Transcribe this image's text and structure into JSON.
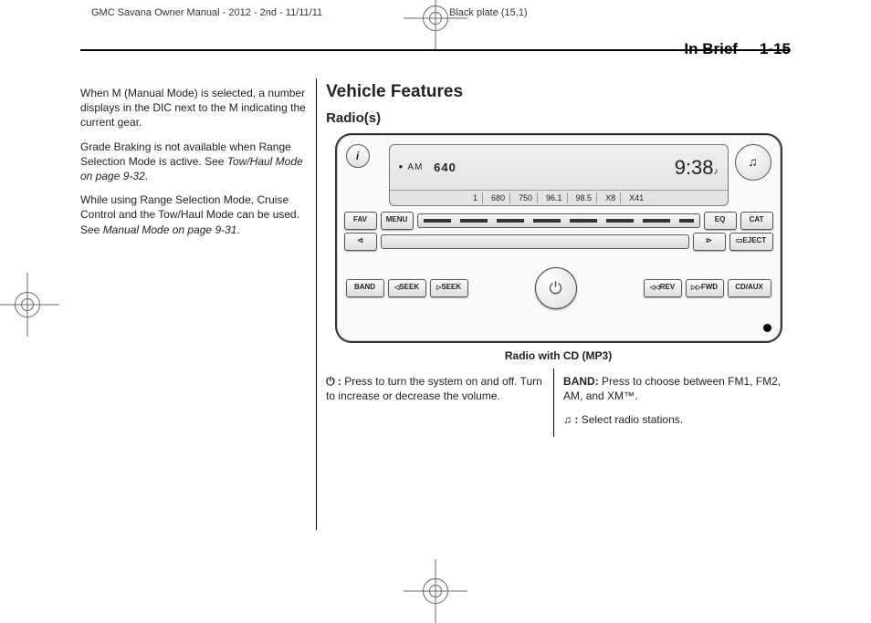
{
  "header": {
    "left": "GMC Savana Owner Manual - 2012 - 2nd - 11/11/11",
    "right": "Black plate (15,1)"
  },
  "running": {
    "section": "In Brief",
    "page": "1-15"
  },
  "col1": {
    "p1": "When M (Manual Mode) is selected, a number displays in the DIC next to the M indicating the current gear.",
    "p2a": "Grade Braking is not available when Range Selection Mode is active. See ",
    "p2i": "Tow/Haul Mode on page 9-32",
    "p2b": ".",
    "p3a": "While using Range Selection Mode, Cruise Control and the Tow/Haul Mode can be used. See ",
    "p3i": "Manual Mode on page 9-31",
    "p3b": "."
  },
  "main": {
    "h1": "Vehicle Features",
    "h2": "Radio(s)",
    "figcap": "Radio with CD (MP3)"
  },
  "radio": {
    "info": "i",
    "tune_icon": "♫",
    "band": "AM",
    "freq": "640",
    "time": "9:38",
    "presets": [
      "680",
      "750",
      "96.1",
      "98.5",
      "X8",
      "X41"
    ],
    "preset_idx": "1",
    "fav": "FAV",
    "menu": "MENU",
    "eq": "EQ",
    "cat": "CAT",
    "eject": "EJECT",
    "prev": "▷◁",
    "next": "◁▷",
    "bandbtn": "BAND",
    "seek_prev": "SEEK",
    "seek_next": "SEEK",
    "rev": "REV",
    "fwd": "FWD",
    "cdaux": "CD/AUX"
  },
  "desc": {
    "power_colon": " :",
    "power_text": "  Press to turn the system on and off. Turn to increase or decrease the volume.",
    "band_label": "BAND:",
    "band_text": "  Press to choose between FM1, FM2, AM, and XM™.",
    "tune_colon": " :",
    "tune_text": "  Select radio stations."
  }
}
